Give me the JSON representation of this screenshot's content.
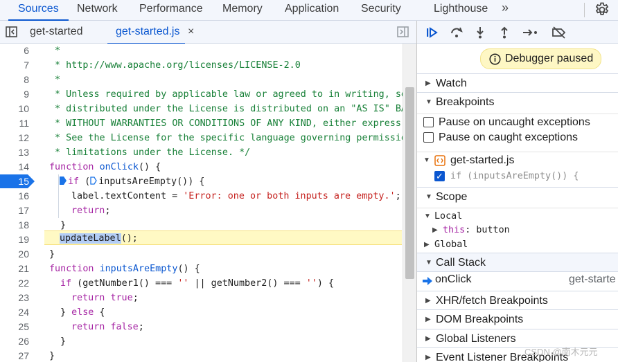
{
  "top_tabs": {
    "sources": "Sources",
    "network": "Network",
    "performance": "Performance",
    "memory": "Memory",
    "application": "Application",
    "security": "Security",
    "lighthouse": "Lighthouse",
    "more": "»"
  },
  "file_tabs": {
    "html": "get-started",
    "js": "get-started.js",
    "close": "×"
  },
  "editor": {
    "current_line": "15",
    "lines": [
      {
        "num": "6",
        "text": " *"
      },
      {
        "num": "7",
        "text": " * http://www.apache.org/licenses/LICENSE-2.0"
      },
      {
        "num": "8",
        "text": " *"
      },
      {
        "num": "9",
        "text": " * Unless required by applicable law or agreed to in writing, so"
      },
      {
        "num": "10",
        "text": " * distributed under the License is distributed on an \"AS IS\" BA"
      },
      {
        "num": "11",
        "text": " * WITHOUT WARRANTIES OR CONDITIONS OF ANY KIND, either express"
      },
      {
        "num": "12",
        "text": " * See the License for the specific language governing permissio"
      },
      {
        "num": "13",
        "text": " * limitations under the License. */"
      },
      {
        "num": "14",
        "kw": "function",
        "fn": "onClick",
        "rest": "() {"
      },
      {
        "num": "15",
        "kw": "if",
        "pre": " (",
        "fn": "inputsAreEmpty",
        "rest": "()) {"
      },
      {
        "num": "16",
        "pre": "label.textContent = ",
        "str": "'Error: one or both inputs are empty.'",
        "rest": ";"
      },
      {
        "num": "17",
        "kw": "return",
        "rest": ";"
      },
      {
        "num": "18",
        "rest": "}"
      },
      {
        "num": "19",
        "sel": "updateLabel",
        "rest": "();"
      },
      {
        "num": "20",
        "rest": "}"
      },
      {
        "num": "21",
        "kw": "function",
        "fn": "inputsAreEmpty",
        "rest": "() {"
      },
      {
        "num": "22",
        "kw": "if",
        "pre": " (getNumber1() === ",
        "str": "''",
        "mid": " || getNumber2() === ",
        "str2": "''",
        "rest": ") {"
      },
      {
        "num": "23",
        "kw": "return",
        "kw2": "true",
        "rest": ";"
      },
      {
        "num": "24",
        "rest": "} ",
        "kw": "else",
        "rest2": " {"
      },
      {
        "num": "25",
        "kw": "return",
        "kw2": "false",
        "rest": ";"
      },
      {
        "num": "26",
        "rest": "}"
      },
      {
        "num": "27",
        "rest": "}"
      }
    ]
  },
  "debugger": {
    "paused": "Debugger paused",
    "watch": "Watch",
    "breakpoints": "Breakpoints",
    "pause_uncaught": "Pause on uncaught exceptions",
    "pause_caught": "Pause on caught exceptions",
    "bp_file": "get-started.js",
    "bp_code": "if (inputsAreEmpty()) {",
    "scope": "Scope",
    "local": "Local",
    "this_key": "this",
    "this_val": "button",
    "global": "Global",
    "call_stack": "Call Stack",
    "frame_fn": "onClick",
    "frame_file": "get-starte",
    "xhr": "XHR/fetch Breakpoints",
    "dom": "DOM Breakpoints",
    "global_listeners": "Global Listeners",
    "event_listener": "Event Listener Breakpoints"
  },
  "watermark": "CSDN @南木元元",
  "colors": {
    "accent": "#0b57d0",
    "paused_bg": "#fef7c4",
    "highlight_line": "#fff9c4"
  }
}
